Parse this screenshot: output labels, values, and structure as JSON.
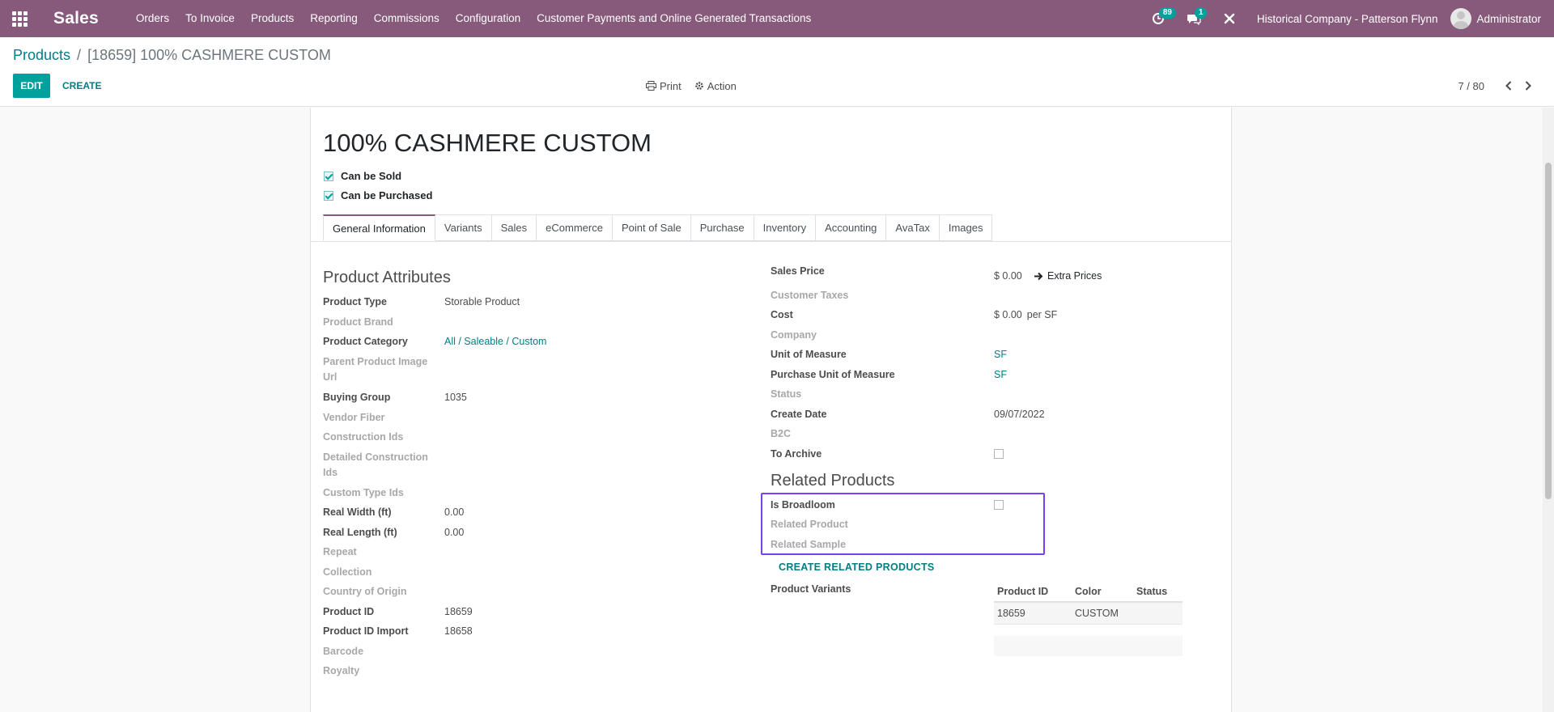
{
  "navbar": {
    "app_name": "Sales",
    "menu": [
      "Orders",
      "To Invoice",
      "Products",
      "Reporting",
      "Commissions",
      "Configuration",
      "Customer Payments and Online Generated Transactions"
    ],
    "activity_count": "89",
    "message_count": "1",
    "company": "Historical Company - Patterson Flynn",
    "user": "Administrator"
  },
  "control_panel": {
    "breadcrumb_parent": "Products",
    "breadcrumb_separator": "/",
    "breadcrumb_current": "[18659] 100% CASHMERE CUSTOM",
    "edit_label": "EDIT",
    "create_label": "CREATE",
    "print_label": "Print",
    "action_label": "Action",
    "pager_value": "7 / 80"
  },
  "form": {
    "title": "100% CASHMERE CUSTOM",
    "can_be_sold": "Can be Sold",
    "can_be_purchased": "Can be Purchased",
    "tabs": [
      "General Information",
      "Variants",
      "Sales",
      "eCommerce",
      "Point of Sale",
      "Purchase",
      "Inventory",
      "Accounting",
      "AvaTax",
      "Images"
    ],
    "left": {
      "section_title": "Product Attributes",
      "product_type_label": "Product Type",
      "product_type_value": "Storable Product",
      "product_brand_label": "Product Brand",
      "product_category_label": "Product Category",
      "product_category_value": "All / Saleable / Custom",
      "parent_image_label_1": "Parent Product Image",
      "parent_image_label_2": "Url",
      "buying_group_label": "Buying Group",
      "buying_group_value": "1035",
      "vendor_fiber_label": "Vendor Fiber",
      "construction_ids_label": "Construction Ids",
      "detailed_construction_label_1": "Detailed Construction",
      "detailed_construction_label_2": "Ids",
      "custom_type_ids_label": "Custom Type Ids",
      "real_width_label": "Real Width (ft)",
      "real_width_value": "0.00",
      "real_length_label": "Real Length (ft)",
      "real_length_value": "0.00",
      "repeat_label": "Repeat",
      "collection_label": "Collection",
      "country_label": "Country of Origin",
      "product_id_label": "Product ID",
      "product_id_value": "18659",
      "product_id_import_label": "Product ID Import",
      "product_id_import_value": "18658",
      "barcode_label": "Barcode",
      "royalty_label": "Royalty"
    },
    "right": {
      "sales_price_label": "Sales Price",
      "sales_price_value": "$ 0.00",
      "extra_prices_label": "Extra Prices",
      "customer_taxes_label": "Customer Taxes",
      "cost_label": "Cost",
      "cost_value": "$ 0.00",
      "cost_unit": "per SF",
      "company_label": "Company",
      "uom_label": "Unit of Measure",
      "uom_value": "SF",
      "purchase_uom_label": "Purchase Unit of Measure",
      "purchase_uom_value": "SF",
      "status_label": "Status",
      "create_date_label": "Create Date",
      "create_date_value": "09/07/2022",
      "b2c_label": "B2C",
      "to_archive_label": "To Archive",
      "related_section_title": "Related Products",
      "is_broadloom_label": "Is Broadloom",
      "related_product_label": "Related Product",
      "related_sample_label": "Related Sample",
      "create_related_label": "CREATE RELATED PRODUCTS",
      "product_variants_label": "Product Variants"
    },
    "variants_table": {
      "headers": [
        "Product ID",
        "Color",
        "Status"
      ],
      "rows": [
        [
          "18659",
          "CUSTOM",
          ""
        ]
      ]
    }
  },
  "colors": {
    "navbar": "#875a7b",
    "primary_button": "#00a09d",
    "link": "#017e84",
    "highlight_border": "#7a40f0"
  }
}
